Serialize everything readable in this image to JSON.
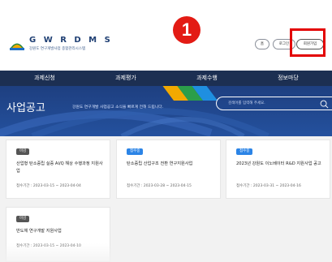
{
  "header": {
    "logo_title": "G W  R D M S",
    "logo_subtitle": "강원도 연구개발사업 종합관리시스템",
    "step_number": "1",
    "util_buttons": [
      "홈",
      "로그인",
      "회원가입"
    ]
  },
  "nav": {
    "items": [
      "과제신청",
      "과제평가",
      "과제수행",
      "정보마당"
    ]
  },
  "hero": {
    "title": "사업공고",
    "description": "강원도 연구개발 사업공고 소식을 빠르게 전해 드립니다.",
    "search_placeholder": "검색어를 입력해 주세요."
  },
  "cards": [
    {
      "status": "마감",
      "title": "산업형 탄소중립 실증 Al/Q 해상 수행과정 지원사업",
      "period": "접수기간 : 2023-03-15 ~ 2023-04-04"
    },
    {
      "status": "접수중",
      "title": "탄소중립 산업구조 전환 연구지원사업",
      "period": "접수기간 : 2023-03-28 ~ 2023-04-15"
    },
    {
      "status": "접수중",
      "title": "2023년 강원도 이노베이터 R&D 지원사업 공고",
      "period": "접수기간 : 2023-03-31 ~ 2023-04-16"
    },
    {
      "status": "마감",
      "title": "반도체 연구개발 지원사업",
      "period": "접수기간 : 2023-03-15 ~ 2023-04-10"
    }
  ],
  "colors": {
    "nav_bg": "#1c2f52",
    "hero_bg": "#24519e",
    "badge_open": "#2b84e6",
    "badge_closed": "#555555",
    "highlight": "#e30000",
    "marker": "#e31b14"
  }
}
